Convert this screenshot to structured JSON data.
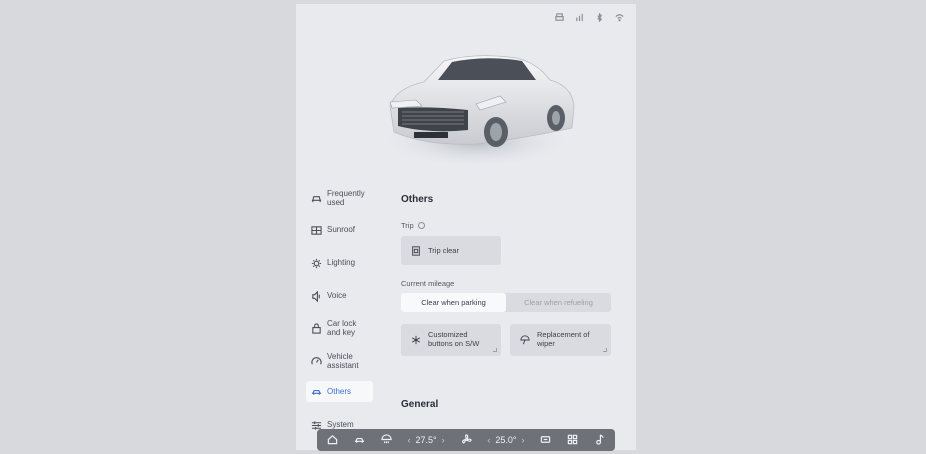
{
  "sidebar": {
    "items": [
      {
        "label": "Frequently used",
        "icon": "car-seat-icon"
      },
      {
        "label": "Sunroof",
        "icon": "sunroof-icon"
      },
      {
        "label": "Lighting",
        "icon": "lighting-icon"
      },
      {
        "label": "Voice",
        "icon": "voice-icon"
      },
      {
        "label": "Car lock and key",
        "icon": "lock-icon"
      },
      {
        "label": "Vehicle assistant",
        "icon": "gauge-icon"
      },
      {
        "label": "Others",
        "icon": "car-icon",
        "active": true
      },
      {
        "label": "System",
        "icon": "sliders-icon"
      }
    ]
  },
  "main": {
    "others_title": "Others",
    "trip_label": "Trip",
    "trip_clear_label": "Trip clear",
    "mileage_label": "Current mileage",
    "mileage_options": [
      "Clear when parking",
      "Clear when refueling"
    ],
    "mileage_selected": "Clear when parking",
    "custom_buttons_label": "Customized buttons on S/W",
    "wiper_label": "Replacement of wiper",
    "general_title": "General"
  },
  "dock": {
    "left_temp": "27.5°",
    "right_temp": "25.0°"
  },
  "colors": {
    "accent": "#3d6fd1",
    "panel_bg": "#e8eaee",
    "dock_bg": "#6e7278"
  }
}
